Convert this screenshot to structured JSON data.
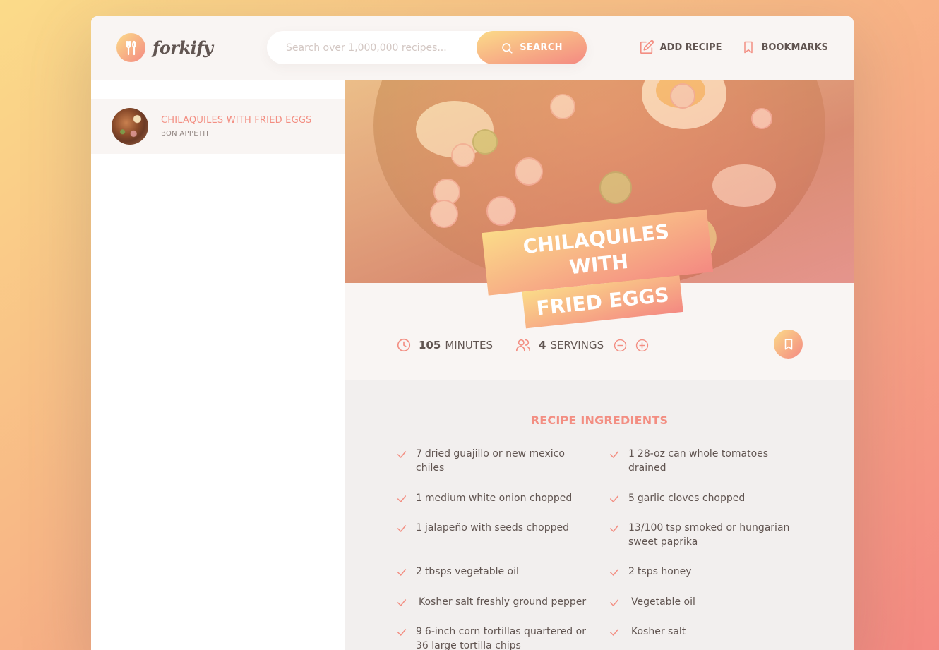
{
  "header": {
    "logo_text": "forkify",
    "search_placeholder": "Search over 1,000,000 recipes...",
    "search_button": "SEARCH",
    "nav": [
      {
        "label": "ADD RECIPE",
        "icon": "edit-icon"
      },
      {
        "label": "BOOKMARKS",
        "icon": "bookmark-icon"
      }
    ]
  },
  "results": [
    {
      "title": "CHILAQUILES WITH FRIED EGGS",
      "publisher": "BON APPETIT"
    }
  ],
  "recipe": {
    "title_line1": "CHILAQUILES WITH",
    "title_line2": "FRIED EGGS",
    "minutes": "105",
    "minutes_label": "MINUTES",
    "servings": "4",
    "servings_label": "SERVINGS",
    "ingredients_heading": "RECIPE INGREDIENTS",
    "ingredients": [
      {
        "quantity": "7",
        "description": "dried guajillo or new mexico chiles"
      },
      {
        "quantity": "1",
        "description": "28-oz can whole tomatoes drained"
      },
      {
        "quantity": "1",
        "description": "medium white onion chopped"
      },
      {
        "quantity": "5",
        "description": "garlic cloves chopped"
      },
      {
        "quantity": "1",
        "description": "jalapeño with seeds chopped"
      },
      {
        "quantity": "13/100",
        "description": "tsp smoked or hungarian sweet paprika"
      },
      {
        "quantity": "2",
        "description": "tbsps vegetable oil"
      },
      {
        "quantity": "2",
        "description": "tsps honey"
      },
      {
        "quantity": "",
        "description": "Kosher salt freshly ground pepper"
      },
      {
        "quantity": "",
        "description": "Vegetable oil"
      },
      {
        "quantity": "9",
        "description": "6-inch corn tortillas quartered or 36 large tortilla chips"
      },
      {
        "quantity": "",
        "description": "Kosher salt"
      }
    ]
  },
  "colors": {
    "accent": "#f38e82",
    "gradient_start": "#fbdb89",
    "gradient_end": "#f48982",
    "text": "#615551"
  }
}
